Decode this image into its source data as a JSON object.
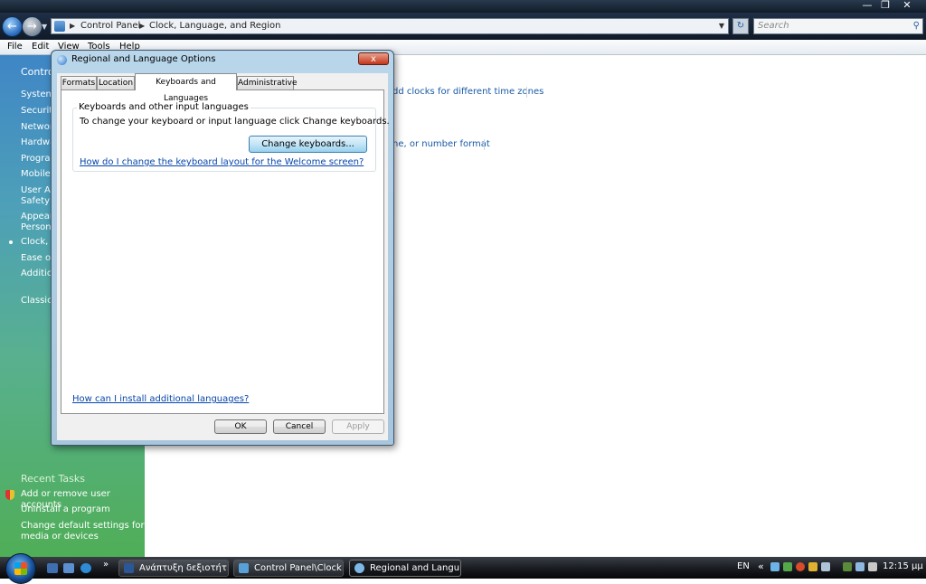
{
  "window": {
    "address_crumbs": [
      "Control Panel",
      "Clock, Language, and Region"
    ],
    "search_placeholder": "Search",
    "menu": [
      "File",
      "Edit",
      "View",
      "Tools",
      "Help"
    ]
  },
  "left_pane": {
    "items": [
      "Control",
      "System",
      "Security",
      "Network",
      "Hardwa",
      "Program",
      "Mobile",
      "User Ac",
      "Safety",
      "Appear",
      "Persona",
      "Clock, L",
      "Ease of",
      "Additio",
      "Classic"
    ],
    "recent_tasks_title": "Recent Tasks",
    "recent_tasks": [
      "Add or remove user accounts",
      "Uninstall a program",
      "Change default settings for",
      "media or devices"
    ]
  },
  "main": {
    "link1": "dd clocks for different time zones",
    "link2": "ne, or number format"
  },
  "dialog": {
    "title": "Regional and Language Options",
    "close": "x",
    "tabs": [
      "Formats",
      "Location",
      "Keyboards and Languages",
      "Administrative"
    ],
    "active_tab": "Keyboards and Languages",
    "group_title": "Keyboards and other input languages",
    "group_desc": "To change your keyboard or input language click Change keyboards.",
    "change_keyboards_button": "Change keyboards...",
    "welcome_link": "How do I change the keyboard layout for the Welcome screen?",
    "install_link": "How can I install additional languages?",
    "ok": "OK",
    "cancel": "Cancel",
    "apply": "Apply"
  },
  "taskbar": {
    "buttons": [
      "Ανάπτυξη δεξιοτήτ...",
      "Control Panel\\Clock...",
      "Regional and Langu..."
    ],
    "active_button": "Regional and Langu...",
    "language": "EN",
    "clock": "12:15 μμ",
    "chevron": "«"
  }
}
